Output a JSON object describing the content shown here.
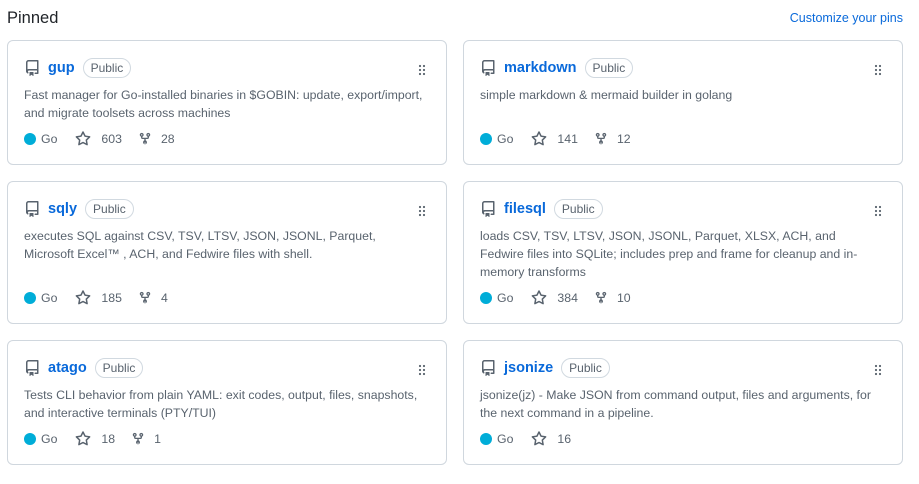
{
  "header": {
    "title": "Pinned",
    "customize_label": "Customize your pins"
  },
  "colors": {
    "link": "#0969da",
    "go_language": "#00ADD8",
    "muted": "#59636e",
    "border": "#d0d7de"
  },
  "badge_label": "Public",
  "repos": [
    {
      "name": "gup",
      "visibility": "Public",
      "description": "Fast manager for Go-installed binaries in $GOBIN: update, export/import, and migrate toolsets across machines",
      "language": "Go",
      "stars": "603",
      "forks": "28"
    },
    {
      "name": "markdown",
      "visibility": "Public",
      "description": "simple markdown & mermaid builder in golang",
      "language": "Go",
      "stars": "141",
      "forks": "12"
    },
    {
      "name": "sqly",
      "visibility": "Public",
      "description": "executes SQL against CSV, TSV, LTSV, JSON, JSONL, Parquet, Microsoft Excel™ , ACH, and Fedwire files with shell.",
      "language": "Go",
      "stars": "185",
      "forks": "4"
    },
    {
      "name": "filesql",
      "visibility": "Public",
      "description": "loads CSV, TSV, LTSV, JSON, JSONL, Parquet, XLSX, ACH, and Fedwire files into SQLite; includes prep and frame for cleanup and in-memory transforms",
      "language": "Go",
      "stars": "384",
      "forks": "10"
    },
    {
      "name": "atago",
      "visibility": "Public",
      "description": "Tests CLI behavior from plain YAML: exit codes, output, files, snapshots, and interactive terminals (PTY/TUI)",
      "language": "Go",
      "stars": "18",
      "forks": "1"
    },
    {
      "name": "jsonize",
      "visibility": "Public",
      "description": "jsonize(jz) - Make JSON from command output, files and arguments, for the next command in a pipeline.",
      "language": "Go",
      "stars": "16",
      "forks": ""
    }
  ]
}
